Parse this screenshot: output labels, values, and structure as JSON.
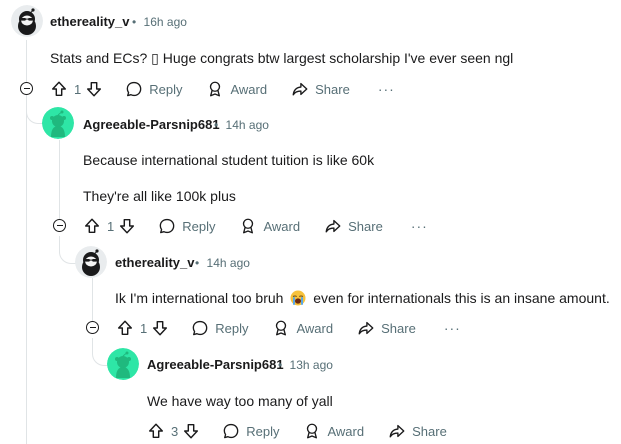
{
  "comments": [
    {
      "author": "ethereality_v",
      "time": "16h ago",
      "lines": [
        "Stats and ECs? ▯ Huge congrats btw largest scholarship I've ever seen ngl"
      ],
      "votes": "1",
      "reply_label": "Reply",
      "award_label": "Award",
      "share_label": "Share",
      "more_label": "···",
      "avatar": "user-avatar-sunglasses"
    },
    {
      "author": "Agreeable-Parsnip681",
      "time": "14h ago",
      "lines": [
        "Because international student tuition is like 60k",
        "They're all like 100k plus"
      ],
      "votes": "1",
      "reply_label": "Reply",
      "award_label": "Award",
      "share_label": "Share",
      "more_label": "···",
      "avatar": "user-avatar-snoo-green"
    },
    {
      "author": "ethereality_v",
      "time": "14h ago",
      "line_before_emoji": "Ik I'm international too bruh",
      "line_after_emoji": "even for internationals this is an insane amount.",
      "emoji": "loudly-crying-face-icon",
      "votes": "1",
      "reply_label": "Reply",
      "award_label": "Award",
      "share_label": "Share",
      "more_label": "···",
      "avatar": "user-avatar-sunglasses"
    },
    {
      "author": "Agreeable-Parsnip681",
      "time": "13h ago",
      "lines": [
        "We have way too many of yall"
      ],
      "votes": "3",
      "reply_label": "Reply",
      "award_label": "Award",
      "share_label": "Share",
      "avatar": "user-avatar-snoo-green"
    }
  ],
  "separator": "•",
  "colors": {
    "meta": "#576f76",
    "snoo_bg": "#2ee6a6",
    "thread_line": "#e0e4e6"
  }
}
